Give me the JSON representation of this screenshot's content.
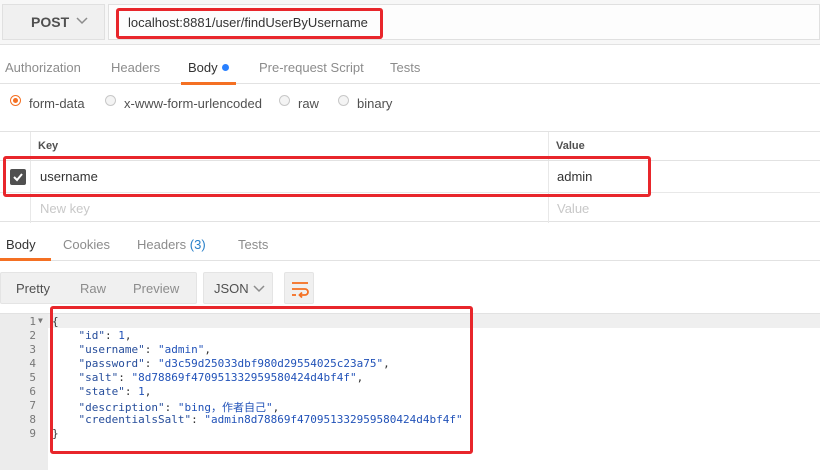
{
  "request": {
    "method": "POST",
    "url": "localhost:8881/user/findUserByUsername"
  },
  "request_tabs": [
    {
      "label": "Authorization"
    },
    {
      "label": "Headers"
    },
    {
      "label": "Body"
    },
    {
      "label": "Pre-request Script"
    },
    {
      "label": "Tests"
    }
  ],
  "body_types": [
    {
      "label": "form-data",
      "selected": true
    },
    {
      "label": "x-www-form-urlencoded",
      "selected": false
    },
    {
      "label": "raw",
      "selected": false
    },
    {
      "label": "binary",
      "selected": false
    }
  ],
  "params_table": {
    "headers": {
      "key": "Key",
      "value": "Value"
    },
    "rows": [
      {
        "checked": true,
        "key": "username",
        "value": "admin"
      }
    ],
    "placeholder": {
      "key": "New key",
      "value": "Value"
    }
  },
  "response_tabs": [
    {
      "label": "Body"
    },
    {
      "label": "Cookies"
    },
    {
      "label": "Headers",
      "count": "(3)"
    },
    {
      "label": "Tests"
    }
  ],
  "view_modes": [
    "Pretty",
    "Raw",
    "Preview"
  ],
  "format": "JSON",
  "response_lines": [
    {
      "n": "1",
      "text": "{"
    },
    {
      "n": "2",
      "key": "\"id\"",
      "val": "1",
      "comma": ","
    },
    {
      "n": "3",
      "key": "\"username\"",
      "val": "\"admin\"",
      "comma": ","
    },
    {
      "n": "4",
      "key": "\"password\"",
      "val": "\"d3c59d25033dbf980d29554025c23a75\"",
      "comma": ","
    },
    {
      "n": "5",
      "key": "\"salt\"",
      "val": "\"8d78869f470951332959580424d4bf4f\"",
      "comma": ","
    },
    {
      "n": "6",
      "key": "\"state\"",
      "val": "1",
      "comma": ","
    },
    {
      "n": "7",
      "key": "\"description\"",
      "val": "\"bing，作者自己\"",
      "comma": ","
    },
    {
      "n": "8",
      "key": "\"credentialsSalt\"",
      "val": "\"admin8d78869f470951332959580424d4bf4f\"",
      "comma": ""
    },
    {
      "n": "9",
      "text": "}"
    }
  ],
  "colors": {
    "accent": "#f47023",
    "highlight": "#e8262b",
    "link": "#2980ff"
  }
}
